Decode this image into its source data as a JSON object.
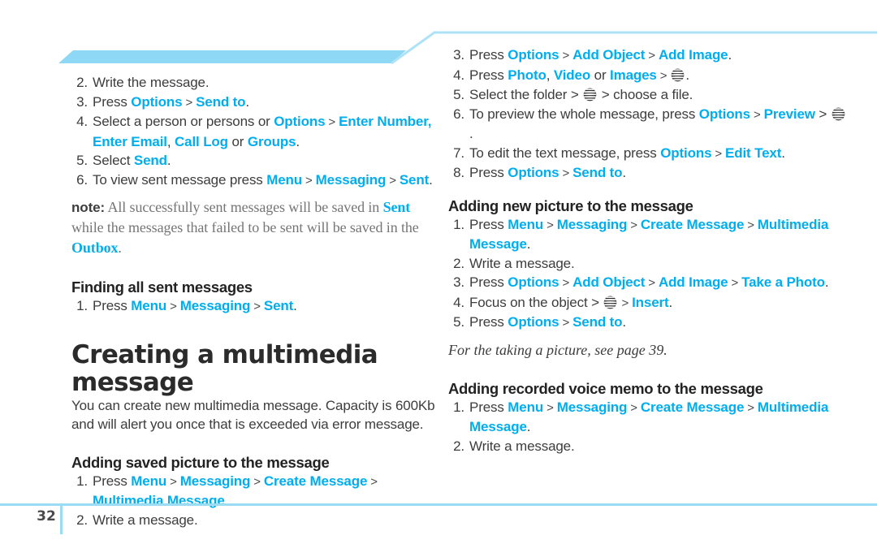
{
  "page": {
    "number": "32",
    "accent_blue": "#00AEEF",
    "band_blue": "#8FD8F5",
    "rule_blue": "#9BDCF5"
  },
  "left_column": {
    "steps_continued": [
      {
        "num": "2.",
        "parts": [
          {
            "t": "Write the message.",
            "k": "plain"
          }
        ]
      },
      {
        "num": "3.",
        "parts": [
          {
            "t": "Press ",
            "k": "plain"
          },
          {
            "t": "Options",
            "k": "link"
          },
          {
            "t": " > ",
            "k": "sep"
          },
          {
            "t": "Send to",
            "k": "link"
          },
          {
            "t": ".",
            "k": "plain"
          }
        ]
      },
      {
        "num": "4.",
        "parts": [
          {
            "t": "Select a person or persons or ",
            "k": "plain"
          },
          {
            "t": "Options",
            "k": "link"
          },
          {
            "t": " > ",
            "k": "sep"
          },
          {
            "t": "Enter Number",
            "k": "link"
          },
          {
            "t": ", ",
            "k": "link"
          },
          {
            "t": "Enter Email",
            "k": "link"
          },
          {
            "t": ", ",
            "k": "plain"
          },
          {
            "t": "Call Log",
            "k": "link"
          },
          {
            "t": " or ",
            "k": "plain"
          },
          {
            "t": "Groups",
            "k": "link"
          },
          {
            "t": ".",
            "k": "plain"
          }
        ]
      },
      {
        "num": "5.",
        "parts": [
          {
            "t": "Select ",
            "k": "plain"
          },
          {
            "t": "Send",
            "k": "link"
          },
          {
            "t": ".",
            "k": "plain"
          }
        ]
      },
      {
        "num": "6.",
        "parts": [
          {
            "t": "To view sent message press ",
            "k": "plain"
          },
          {
            "t": "Menu",
            "k": "link"
          },
          {
            "t": " > ",
            "k": "sep"
          },
          {
            "t": "Messaging",
            "k": "link"
          },
          {
            "t": " > ",
            "k": "sep"
          },
          {
            "t": "Sent",
            "k": "link"
          },
          {
            "t": ".",
            "k": "plain"
          }
        ]
      }
    ],
    "note": {
      "keyword": "note:",
      "parts": [
        {
          "t": " All successfully sent messages will be saved in ",
          "k": "plain"
        },
        {
          "t": "Sent",
          "k": "link"
        },
        {
          "t": " while the messages that failed to be sent will be saved in the ",
          "k": "plain"
        },
        {
          "t": "Outbox",
          "k": "link"
        },
        {
          "t": ".",
          "k": "plain"
        }
      ]
    },
    "section_finding": {
      "heading": "Finding all sent messages",
      "steps": [
        {
          "num": "1.",
          "parts": [
            {
              "t": "Press ",
              "k": "plain"
            },
            {
              "t": "Menu",
              "k": "link"
            },
            {
              "t": " > ",
              "k": "sep"
            },
            {
              "t": "Messaging",
              "k": "link"
            },
            {
              "t": " > ",
              "k": "sep"
            },
            {
              "t": "Sent",
              "k": "link"
            },
            {
              "t": ".",
              "k": "plain"
            }
          ]
        }
      ]
    },
    "section_creating": {
      "title": "Creating a multimedia message",
      "intro": "You can create new multimedia message. Capacity is 600Kb and will alert you once that is exceeded via error message."
    },
    "section_saved_picture": {
      "heading": "Adding saved picture to the message",
      "steps": [
        {
          "num": "1.",
          "parts": [
            {
              "t": "Press ",
              "k": "plain"
            },
            {
              "t": "Menu",
              "k": "link"
            },
            {
              "t": " > ",
              "k": "sep"
            },
            {
              "t": "Messaging",
              "k": "link"
            },
            {
              "t": " > ",
              "k": "sep"
            },
            {
              "t": "Create Message",
              "k": "link"
            },
            {
              "t": " > ",
              "k": "sep"
            },
            {
              "t": "Multimedia Message",
              "k": "link"
            },
            {
              "t": ".",
              "k": "plain"
            }
          ]
        },
        {
          "num": "2.",
          "parts": [
            {
              "t": "Write a message.",
              "k": "plain"
            }
          ]
        }
      ]
    }
  },
  "right_column": {
    "steps_continued": [
      {
        "num": "3.",
        "parts": [
          {
            "t": "Press ",
            "k": "plain"
          },
          {
            "t": "Options",
            "k": "link"
          },
          {
            "t": " > ",
            "k": "sep"
          },
          {
            "t": "Add Object",
            "k": "link"
          },
          {
            "t": " > ",
            "k": "sep"
          },
          {
            "t": "Add Image",
            "k": "link"
          },
          {
            "t": ".",
            "k": "plain"
          }
        ]
      },
      {
        "num": "4.",
        "parts": [
          {
            "t": "Press ",
            "k": "plain"
          },
          {
            "t": "Photo",
            "k": "link"
          },
          {
            "t": ", ",
            "k": "plain"
          },
          {
            "t": "Video",
            "k": "link"
          },
          {
            "t": " or ",
            "k": "plain"
          },
          {
            "t": "Images",
            "k": "link"
          },
          {
            "t": " > ",
            "k": "sep"
          },
          {
            "t": "",
            "k": "globe"
          },
          {
            "t": ".",
            "k": "plain"
          }
        ]
      },
      {
        "num": "5.",
        "parts": [
          {
            "t": "Select the folder > ",
            "k": "plain"
          },
          {
            "t": "",
            "k": "globe"
          },
          {
            "t": " > choose a file.",
            "k": "plain"
          }
        ]
      },
      {
        "num": "6.",
        "parts": [
          {
            "t": "To preview the whole message, press ",
            "k": "plain"
          },
          {
            "t": "Options",
            "k": "link"
          },
          {
            "t": " > ",
            "k": "sep"
          },
          {
            "t": "Preview",
            "k": "link"
          },
          {
            "t": " > ",
            "k": "plain"
          },
          {
            "t": "",
            "k": "globe"
          },
          {
            "t": ".",
            "k": "plain"
          }
        ]
      },
      {
        "num": "7.",
        "parts": [
          {
            "t": "To edit the text message, press ",
            "k": "plain"
          },
          {
            "t": "Options",
            "k": "link"
          },
          {
            "t": " > ",
            "k": "sep"
          },
          {
            "t": "Edit Text",
            "k": "link"
          },
          {
            "t": ".",
            "k": "plain"
          }
        ]
      },
      {
        "num": "8.",
        "parts": [
          {
            "t": "Press ",
            "k": "plain"
          },
          {
            "t": "Options",
            "k": "link"
          },
          {
            "t": " > ",
            "k": "sep"
          },
          {
            "t": "Send to",
            "k": "link"
          },
          {
            "t": ".",
            "k": "plain"
          }
        ]
      }
    ],
    "section_new_picture": {
      "heading": "Adding new picture to the message",
      "steps": [
        {
          "num": "1.",
          "parts": [
            {
              "t": "Press ",
              "k": "plain"
            },
            {
              "t": "Menu",
              "k": "link"
            },
            {
              "t": " > ",
              "k": "sep"
            },
            {
              "t": "Messaging",
              "k": "link"
            },
            {
              "t": " > ",
              "k": "sep"
            },
            {
              "t": "Create Message",
              "k": "link"
            },
            {
              "t": " > ",
              "k": "sep"
            },
            {
              "t": "Multimedia Message",
              "k": "link"
            },
            {
              "t": ".",
              "k": "plain"
            }
          ]
        },
        {
          "num": "2.",
          "parts": [
            {
              "t": "Write a message.",
              "k": "plain"
            }
          ]
        },
        {
          "num": "3.",
          "parts": [
            {
              "t": "Press ",
              "k": "plain"
            },
            {
              "t": "Options",
              "k": "link"
            },
            {
              "t": " > ",
              "k": "sep"
            },
            {
              "t": "Add Object",
              "k": "link"
            },
            {
              "t": " > ",
              "k": "sep"
            },
            {
              "t": "Add Image",
              "k": "link"
            },
            {
              "t": " > ",
              "k": "sep"
            },
            {
              "t": "Take a Photo",
              "k": "link"
            },
            {
              "t": ".",
              "k": "plain"
            }
          ]
        },
        {
          "num": "4.",
          "parts": [
            {
              "t": "Focus on the object > ",
              "k": "plain"
            },
            {
              "t": "",
              "k": "globe"
            },
            {
              "t": " > ",
              "k": "sep"
            },
            {
              "t": "Insert",
              "k": "link"
            },
            {
              "t": ".",
              "k": "plain"
            }
          ]
        },
        {
          "num": "5.",
          "parts": [
            {
              "t": "Press ",
              "k": "plain"
            },
            {
              "t": "Options",
              "k": "link"
            },
            {
              "t": " > ",
              "k": "sep"
            },
            {
              "t": "Send to",
              "k": "link"
            },
            {
              "t": ".",
              "k": "plain"
            }
          ]
        }
      ]
    },
    "cross_reference": "For the taking a picture, see page 39.",
    "section_voice_memo": {
      "heading": "Adding recorded voice memo to the message",
      "steps": [
        {
          "num": "1.",
          "parts": [
            {
              "t": "Press ",
              "k": "plain"
            },
            {
              "t": "Menu",
              "k": "link"
            },
            {
              "t": " > ",
              "k": "sep"
            },
            {
              "t": "Messaging",
              "k": "link"
            },
            {
              "t": " > ",
              "k": "sep"
            },
            {
              "t": "Create Message",
              "k": "link"
            },
            {
              "t": " > ",
              "k": "sep"
            },
            {
              "t": "Multimedia Message",
              "k": "link"
            },
            {
              "t": ".",
              "k": "plain"
            }
          ]
        },
        {
          "num": "2.",
          "parts": [
            {
              "t": "Write a message.",
              "k": "plain"
            }
          ]
        }
      ]
    }
  }
}
